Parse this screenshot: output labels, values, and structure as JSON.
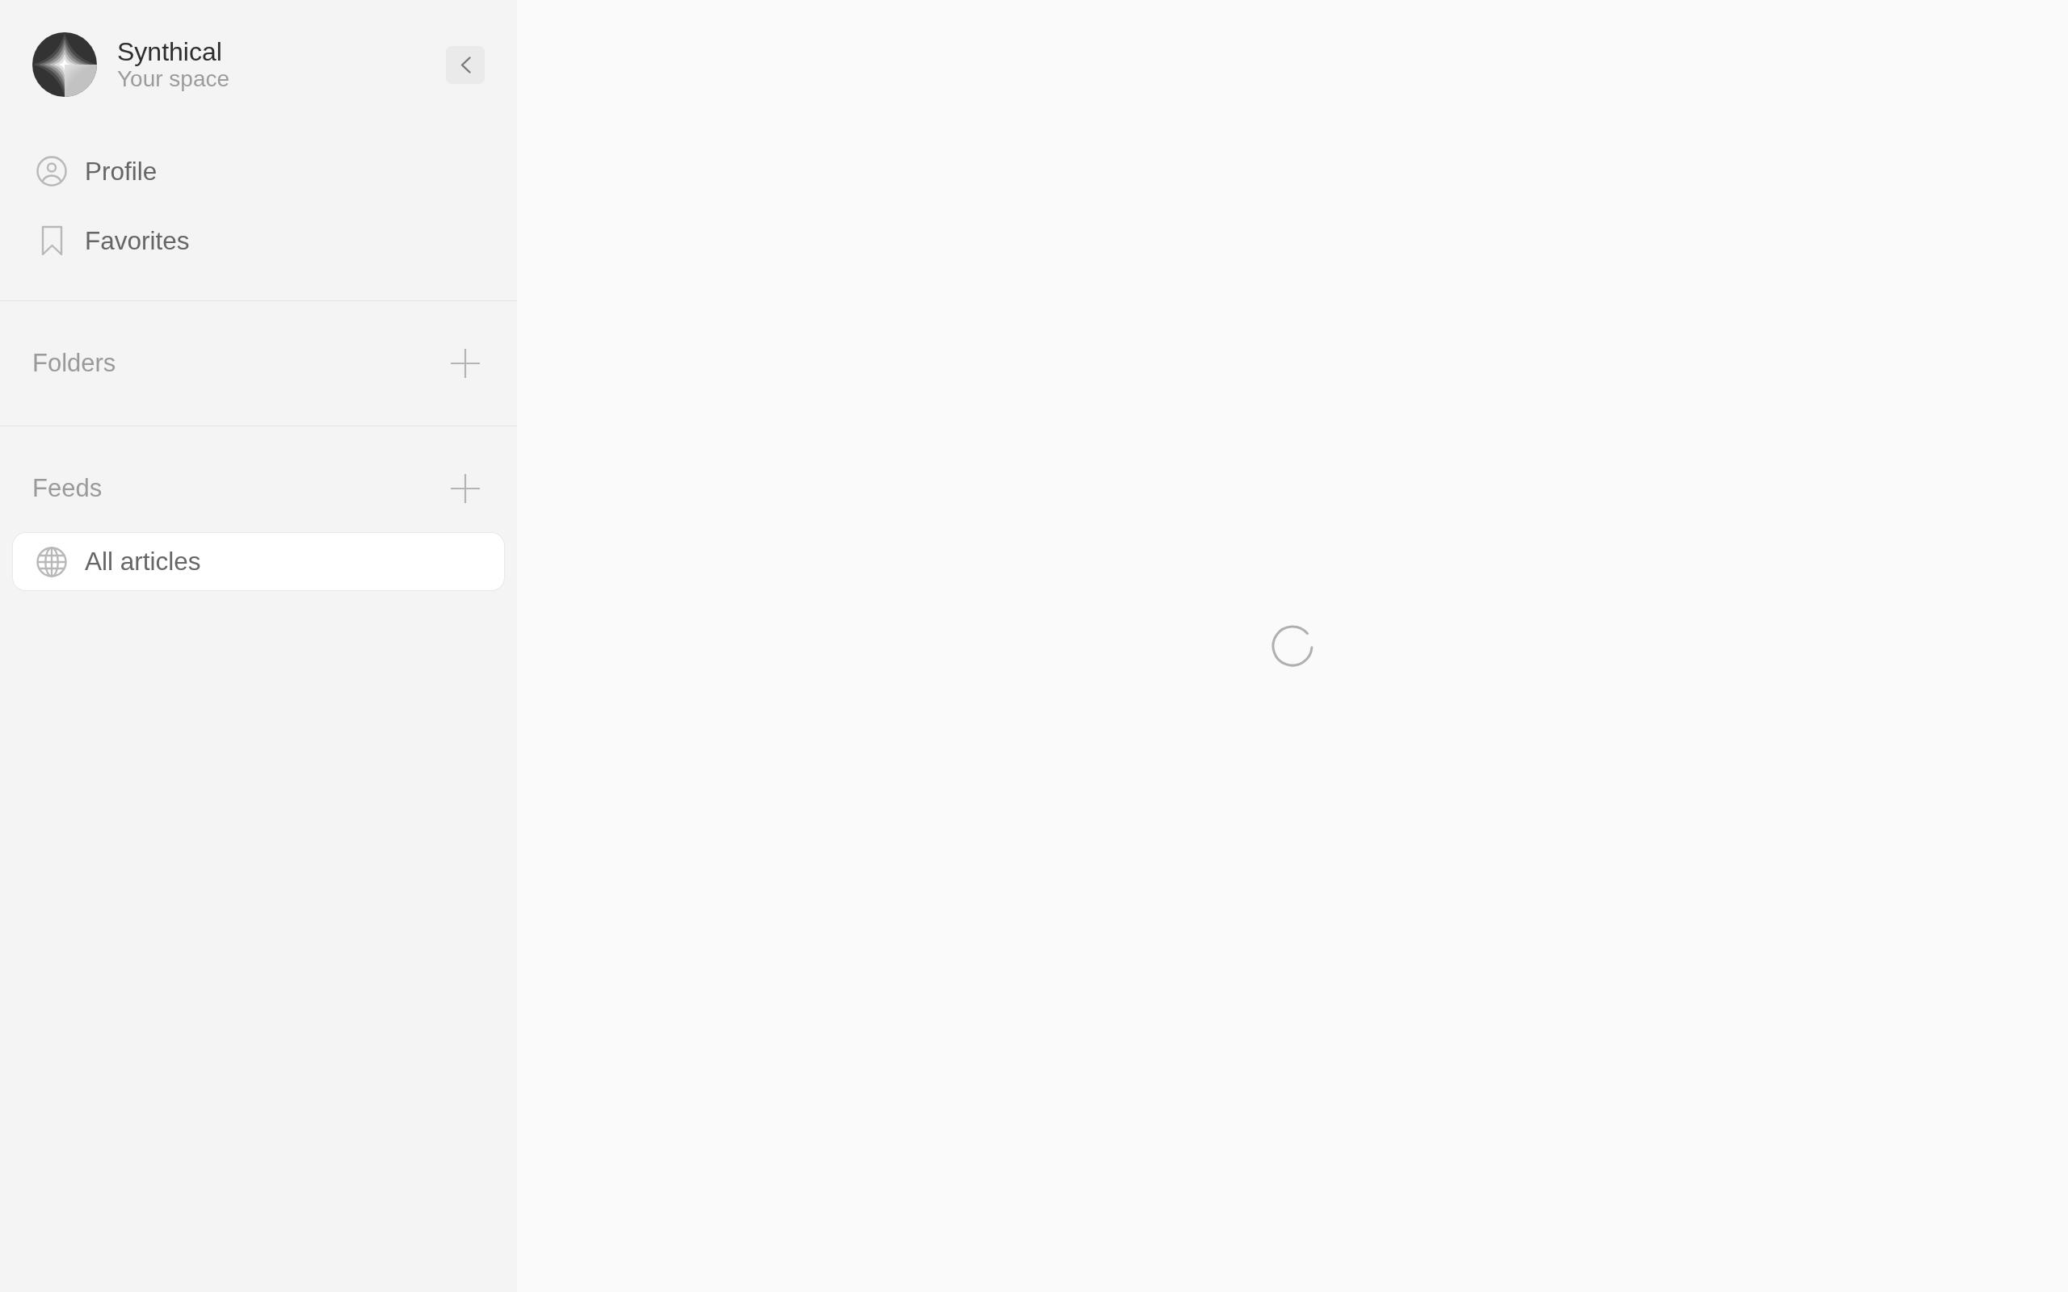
{
  "sidebar": {
    "workspace": {
      "name": "Synthical",
      "subtitle": "Your space"
    },
    "nav": [
      {
        "kind": "profile",
        "label": "Profile"
      },
      {
        "kind": "bookmark",
        "label": "Favorites"
      }
    ],
    "sections": [
      {
        "title": "Folders"
      },
      {
        "title": "Feeds",
        "items": [
          {
            "kind": "globe",
            "label": "All articles",
            "selected": true
          }
        ]
      }
    ]
  },
  "main": {
    "loading": true
  }
}
